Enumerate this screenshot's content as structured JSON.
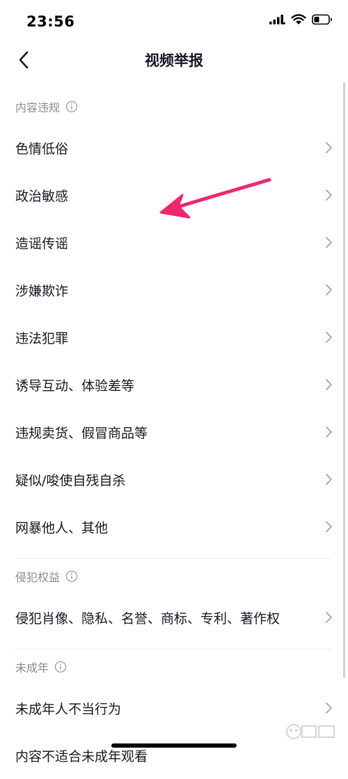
{
  "status_bar": {
    "time": "23:56",
    "icons": [
      "signal-icon",
      "wifi-icon",
      "battery-icon"
    ]
  },
  "nav": {
    "title": "视频举报",
    "back_icon": "chevron-left-icon"
  },
  "sections": [
    {
      "header": "内容违规",
      "items": [
        "色情低俗",
        "政治敏感",
        "造谣传谣",
        "涉嫌欺诈",
        "违法犯罪",
        "诱导互动、体验差等",
        "违规卖货、假冒商品等",
        "疑似/唆使自残自杀",
        "网暴他人、其他"
      ]
    },
    {
      "header": "侵犯权益",
      "items": [
        "侵犯肖像、隐私、名誉、商标、专利、著作权"
      ]
    },
    {
      "header": "未成年",
      "items": [
        "未成年人不当行为",
        "内容不适合未成年观看"
      ]
    }
  ],
  "colors": {
    "text_primary": "#161823",
    "text_secondary": "#8a8b91",
    "chevron": "#a3a4a8",
    "annotation_arrow": "#f0266f"
  }
}
